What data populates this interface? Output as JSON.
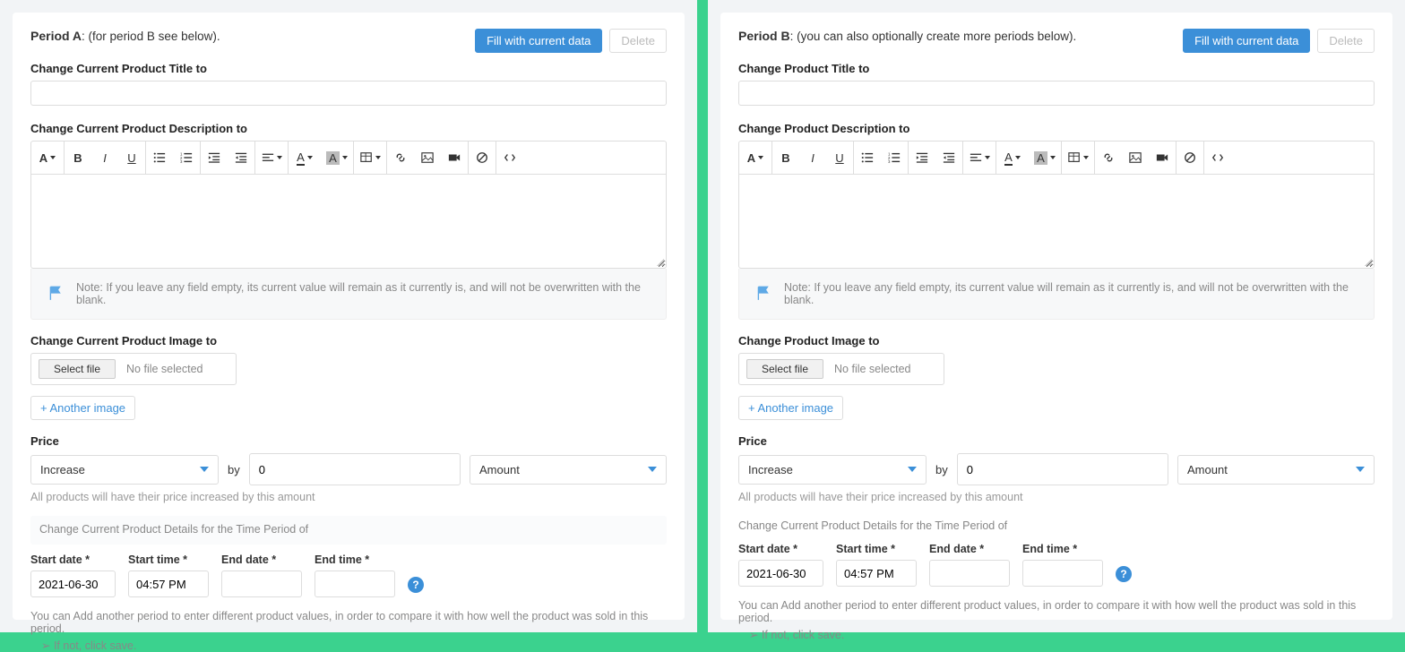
{
  "periodA": {
    "title_bold": "Period A",
    "title_rest": ": (for period B see below).",
    "fill_btn": "Fill with current data",
    "delete_btn": "Delete",
    "title_label": "Change Current Product Title to",
    "desc_label": "Change Current Product Description to",
    "note": "Note: If you leave any field empty, its current value will remain as it currently is, and will not be overwritten with the blank.",
    "image_label": "Change Current Product Image to",
    "select_file": "Select file",
    "no_file": "No file selected",
    "another_image": "+ Another image",
    "price_label": "Price",
    "price_action": "Increase",
    "by": "by",
    "price_value": "0",
    "price_type": "Amount",
    "price_helper": "All products will have their price increased by this amount",
    "period_section": "Change Current Product Details for the Time Period of",
    "start_date_lbl": "Start date *",
    "start_time_lbl": "Start time *",
    "end_date_lbl": "End date *",
    "end_time_lbl": "End time *",
    "start_date": "2021-06-30",
    "start_time": "04:57 PM",
    "end_date": "",
    "end_time": "",
    "footer": "You can Add another period to enter different product values, in order to compare it with how well the product was sold in this period.",
    "footer_sub": "➢  If not, click save."
  },
  "periodB": {
    "title_bold": "Period B",
    "title_rest": ": (you can also optionally create more periods below).",
    "fill_btn": "Fill with current data",
    "delete_btn": "Delete",
    "title_label": "Change Product Title to",
    "desc_label": "Change Product Description to",
    "note": "Note: If you leave any field empty, its current value will remain as it currently is, and will not be overwritten with the blank.",
    "image_label": "Change Product Image to",
    "select_file": "Select file",
    "no_file": "No file selected",
    "another_image": "+ Another image",
    "price_label": "Price",
    "price_action": "Increase",
    "by": "by",
    "price_value": "0",
    "price_type": "Amount",
    "price_helper": "All products will have their price increased by this amount",
    "period_section": "Change Current Product Details for the Time Period of",
    "start_date_lbl": "Start date *",
    "start_time_lbl": "Start time *",
    "end_date_lbl": "End date *",
    "end_time_lbl": "End time *",
    "start_date": "2021-06-30",
    "start_time": "04:57 PM",
    "end_date": "",
    "end_time": "",
    "footer": "You can Add another period to enter different product values, in order to compare it with how well the product was sold in this period.",
    "footer_sub": "➢  If not, click save."
  }
}
